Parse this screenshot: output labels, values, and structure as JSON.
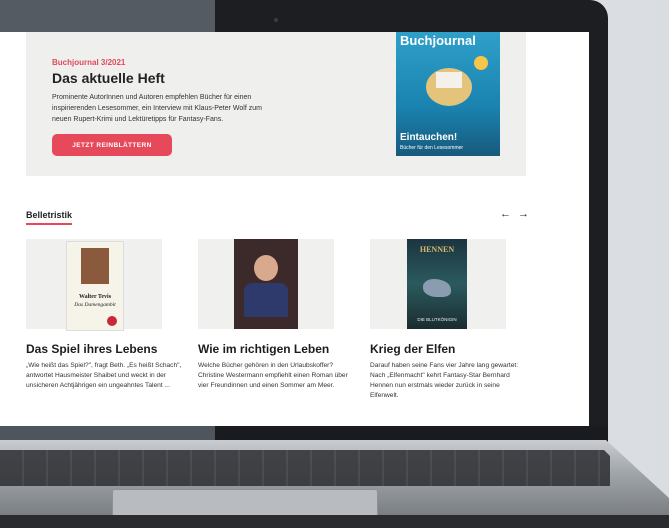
{
  "hero": {
    "issue_label": "Buchjournal 3/2021",
    "title": "Das aktuelle Heft",
    "text": "Prominente AutorInnen und Autoren empfehlen Bücher für einen inspirierenden Lesesommer, ein Interview mit Klaus-Peter Wolf zum neuen Rupert-Krimi und Lektüretipps für Fantasy-Fans.",
    "button_label": "JETZT REINBLÄTTERN",
    "magazine_title": "Buchjournal",
    "magazine_headline": "Eintauchen!",
    "magazine_sub": "Bücher für den Lesesommer"
  },
  "section": {
    "title": "Belletristik",
    "prev_icon": "arrow-left-icon",
    "next_icon": "arrow-right-icon",
    "prev_glyph": "←",
    "next_glyph": "→"
  },
  "cards": [
    {
      "title": "Das Spiel ihres Lebens",
      "text": "„Wie heißt das Spiel?\", fragt Beth. „Es heißt Schach\", antwortet Hausmeister Shaibet und weckt in der unsicheren Achtjährigen ein ungeahntes Talent ...",
      "cover_author": "Walter Tevis",
      "cover_title": "Das Damengambit"
    },
    {
      "title": "Wie im richtigen Leben",
      "text": "Welche Bücher gehören in den Urlaubskoffer? Christine Westermann empfiehlt einen Roman über vier Freundinnen und einen Sommer am Meer."
    },
    {
      "title": "Krieg der Elfen",
      "text": "Darauf haben seine Fans vier Jahre lang gewartet: Nach „Elfenmacht\" kehrt Fantasy-Star Bernhard Hennen nun erstmals wieder zurück in seine Elfenwelt.",
      "cover_author": "HENNEN",
      "cover_title": "DIE BLUTKÖNIGIN"
    }
  ],
  "colors": {
    "accent": "#e6495a",
    "hero_bg": "#efefee"
  }
}
